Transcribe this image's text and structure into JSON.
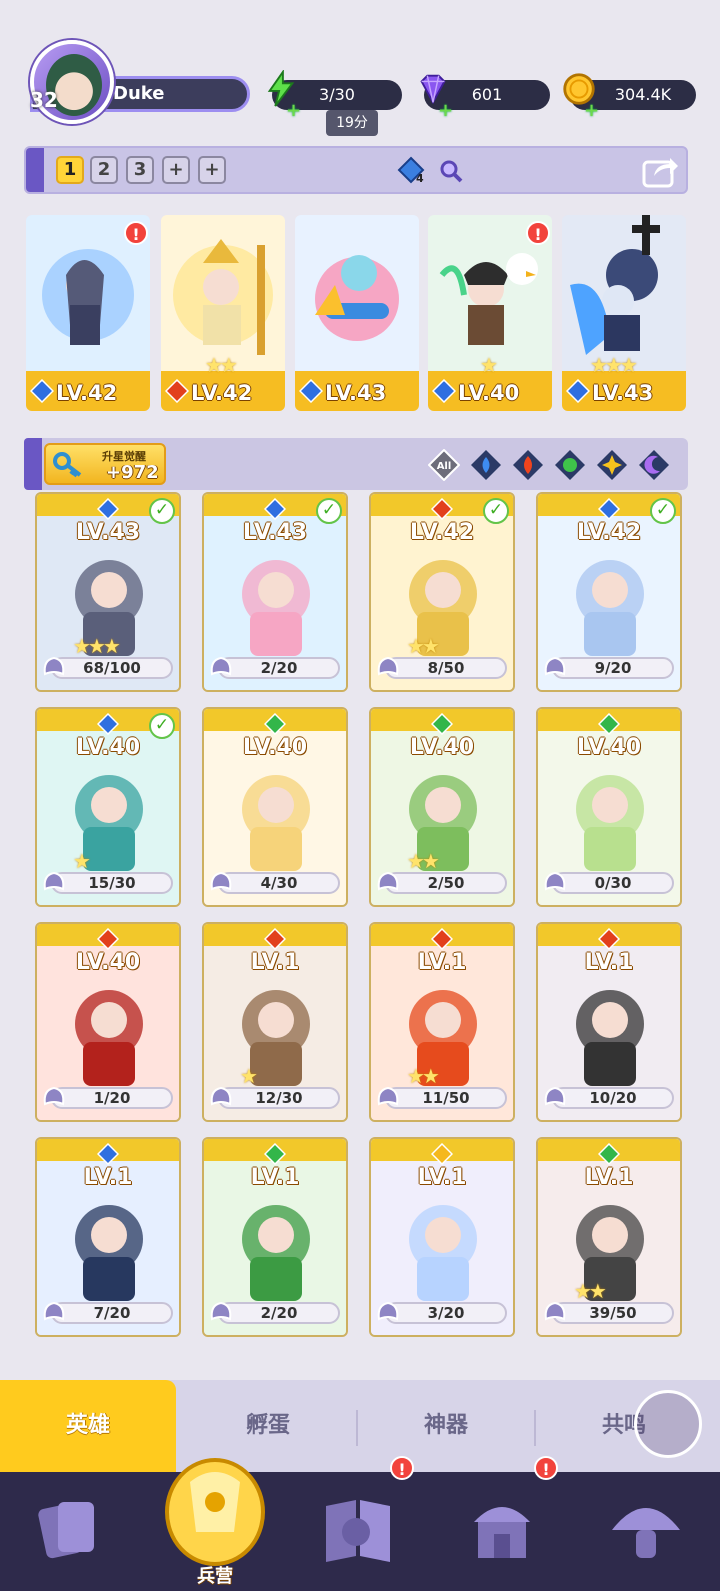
{
  "player": {
    "name": "Duke",
    "level": "32"
  },
  "resources": {
    "energy": {
      "value": "3/30",
      "timer": "19分",
      "icon": "lightning-icon"
    },
    "gems": {
      "value": "601",
      "icon": "purple-gem-icon"
    },
    "gold": {
      "value": "304.4K",
      "icon": "gold-coin-icon"
    }
  },
  "team_bar": {
    "slots": [
      "1",
      "2",
      "3",
      "+",
      "+"
    ],
    "active_slot": "1",
    "water_count": "4"
  },
  "team": [
    {
      "level": "LV.42",
      "element": "water",
      "stars": 0,
      "alert": "!"
    },
    {
      "level": "LV.42",
      "element": "fire",
      "stars": 2,
      "alert": ""
    },
    {
      "level": "LV.43",
      "element": "water",
      "stars": 0,
      "alert": ""
    },
    {
      "level": "LV.40",
      "element": "water",
      "stars": 1,
      "alert": "!"
    },
    {
      "level": "LV.43",
      "element": "water",
      "stars": 3,
      "alert": ""
    }
  ],
  "filter_bar": {
    "awaken_title": "升星觉醒",
    "awaken_value": "+972",
    "filters": [
      "All",
      "water",
      "fire",
      "nature",
      "light",
      "dark"
    ]
  },
  "heroes": [
    {
      "level": "LV.43",
      "element": "water",
      "progress": "68/100",
      "stars": 3,
      "check": true
    },
    {
      "level": "LV.43",
      "element": "water",
      "progress": "2/20",
      "stars": 0,
      "check": true
    },
    {
      "level": "LV.42",
      "element": "fire",
      "progress": "8/50",
      "stars": 2,
      "check": true
    },
    {
      "level": "LV.42",
      "element": "water",
      "progress": "9/20",
      "stars": 0,
      "check": true
    },
    {
      "level": "LV.40",
      "element": "water",
      "progress": "15/30",
      "stars": 1,
      "check": true
    },
    {
      "level": "LV.40",
      "element": "nature",
      "progress": "4/30",
      "stars": 0,
      "check": false
    },
    {
      "level": "LV.40",
      "element": "nature",
      "progress": "2/50",
      "stars": 2,
      "check": false
    },
    {
      "level": "LV.40",
      "element": "nature",
      "progress": "0/30",
      "stars": 0,
      "check": false
    },
    {
      "level": "LV.40",
      "element": "fire",
      "progress": "1/20",
      "stars": 0,
      "check": false
    },
    {
      "level": "LV.1",
      "element": "fire",
      "progress": "12/30",
      "stars": 1,
      "check": false
    },
    {
      "level": "LV.1",
      "element": "fire",
      "progress": "11/50",
      "stars": 2,
      "check": false
    },
    {
      "level": "LV.1",
      "element": "fire",
      "progress": "10/20",
      "stars": 0,
      "check": false
    },
    {
      "level": "LV.1",
      "element": "water",
      "progress": "7/20",
      "stars": 0,
      "check": false
    },
    {
      "level": "LV.1",
      "element": "nature",
      "progress": "2/20",
      "stars": 0,
      "check": false
    },
    {
      "level": "LV.1",
      "element": "light",
      "progress": "3/20",
      "stars": 0,
      "check": false
    },
    {
      "level": "LV.1",
      "element": "nature",
      "progress": "39/50",
      "stars": 2,
      "check": false
    }
  ],
  "tabs": [
    "英雄",
    "孵蛋",
    "神器",
    "共鸣"
  ],
  "nav": {
    "items": [
      "cards-icon",
      "barracks-icon",
      "map-book-icon",
      "temple-icon",
      "mushroom-icon"
    ],
    "barracks_label": "兵营",
    "alerts": [
      "!",
      "!"
    ]
  },
  "colors": {
    "accent": "#6a57c4",
    "gold": "#f6bd22",
    "nav": "#2e2a4b"
  }
}
